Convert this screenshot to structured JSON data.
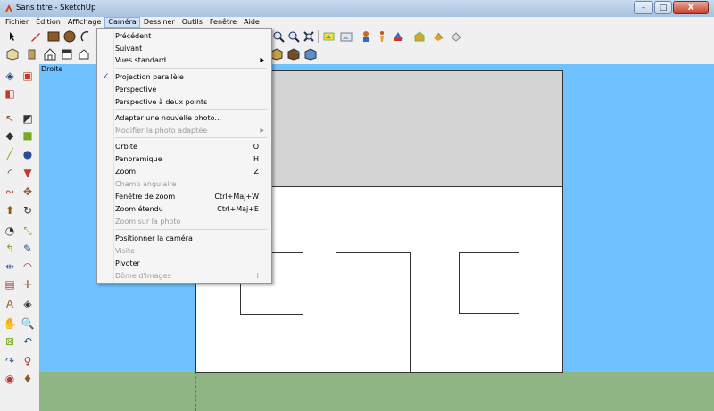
{
  "window": {
    "title": "Sans titre - SketchUp",
    "buttons": {
      "minimize": "–",
      "maximize": "□",
      "close": "X"
    }
  },
  "menubar": [
    "Fichier",
    "Édition",
    "Affichage",
    "Caméra",
    "Dessiner",
    "Outils",
    "Fenêtre",
    "Aide"
  ],
  "camera_menu": {
    "items": [
      {
        "label": "Précédent",
        "shortcut": "",
        "submenu": false,
        "checked": false,
        "disabled": false
      },
      {
        "label": "Suivant",
        "shortcut": "",
        "submenu": false,
        "checked": false,
        "disabled": false
      },
      {
        "label": "Vues standard",
        "shortcut": "",
        "submenu": true,
        "checked": false,
        "disabled": false
      },
      {
        "label": "Projection parallèle",
        "shortcut": "",
        "submenu": false,
        "checked": true,
        "disabled": false
      },
      {
        "label": "Perspective",
        "shortcut": "",
        "submenu": false,
        "checked": false,
        "disabled": false
      },
      {
        "label": "Perspective à deux points",
        "shortcut": "",
        "submenu": false,
        "checked": false,
        "disabled": false
      },
      {
        "label": "Adapter une nouvelle photo...",
        "shortcut": "",
        "submenu": false,
        "checked": false,
        "disabled": false
      },
      {
        "label": "Modifier la photo adaptée",
        "shortcut": "",
        "submenu": true,
        "checked": false,
        "disabled": true
      },
      {
        "label": "Orbite",
        "shortcut": "O",
        "submenu": false,
        "checked": false,
        "disabled": false
      },
      {
        "label": "Panoramique",
        "shortcut": "H",
        "submenu": false,
        "checked": false,
        "disabled": false
      },
      {
        "label": "Zoom",
        "shortcut": "Z",
        "submenu": false,
        "checked": false,
        "disabled": false
      },
      {
        "label": "Champ angulaire",
        "shortcut": "",
        "submenu": false,
        "checked": false,
        "disabled": true
      },
      {
        "label": "Fenêtre de zoom",
        "shortcut": "Ctrl+Maj+W",
        "submenu": false,
        "checked": false,
        "disabled": false
      },
      {
        "label": "Zoom étendu",
        "shortcut": "Ctrl+Maj+E",
        "submenu": false,
        "checked": false,
        "disabled": false
      },
      {
        "label": "Zoom sur la photo",
        "shortcut": "",
        "submenu": false,
        "checked": false,
        "disabled": true
      },
      {
        "label": "Positionner la caméra",
        "shortcut": "",
        "submenu": false,
        "checked": false,
        "disabled": false
      },
      {
        "label": "Visite",
        "shortcut": "",
        "submenu": false,
        "checked": false,
        "disabled": true
      },
      {
        "label": "Pivoter",
        "shortcut": "",
        "submenu": false,
        "checked": false,
        "disabled": false
      },
      {
        "label": "Dôme d'images",
        "shortcut": "I",
        "submenu": false,
        "checked": false,
        "disabled": true
      }
    ],
    "check_glyph": "✓",
    "submenu_glyph": "▶"
  },
  "viewport": {
    "scene_label": "Droite"
  },
  "colors": {
    "sky": "#6ec2ff",
    "ground": "#8fb584",
    "roof": "#d4d4d4",
    "facade": "#ffffff"
  },
  "toolbar_icons": {
    "row1": [
      "select-icon",
      "pencil-icon",
      "rectangle-icon",
      "circle-icon",
      "arc-icon",
      "zoom-icon",
      "zoom-extents-icon",
      "scenes-icon",
      "photo-icon",
      "components-icon",
      "styles-icon",
      "model-info-icon",
      "warehouse-icon",
      "extension-icon"
    ],
    "row2": [
      "iso-view-icon",
      "front-view-icon",
      "home-view-icon",
      "back-view-icon",
      "outline-icon",
      "style-shaded-icon",
      "style-texture-icon",
      "style-mono-icon"
    ]
  },
  "palette_icons": [
    "orbit-icon",
    "component-icon",
    "section-icon",
    "select-icon",
    "eraser-icon",
    "paint-icon",
    "rectangle-icon",
    "pencil-icon",
    "circle-icon",
    "arc-icon",
    "polygon-icon",
    "freehand-icon",
    "move-icon",
    "pushpull-icon",
    "rotate-icon",
    "followme-icon",
    "scale-icon",
    "offset-icon",
    "tape-icon",
    "dimension-icon",
    "protractor-icon",
    "text-icon",
    "axes-icon",
    "3dtext-icon",
    "orbit-icon",
    "pan-icon",
    "zoom-icon",
    "zoomwindow-icon",
    "prev-icon",
    "next-icon",
    "position-camera-icon",
    "lookaround-icon",
    "walk-icon",
    "section-plane-icon"
  ]
}
